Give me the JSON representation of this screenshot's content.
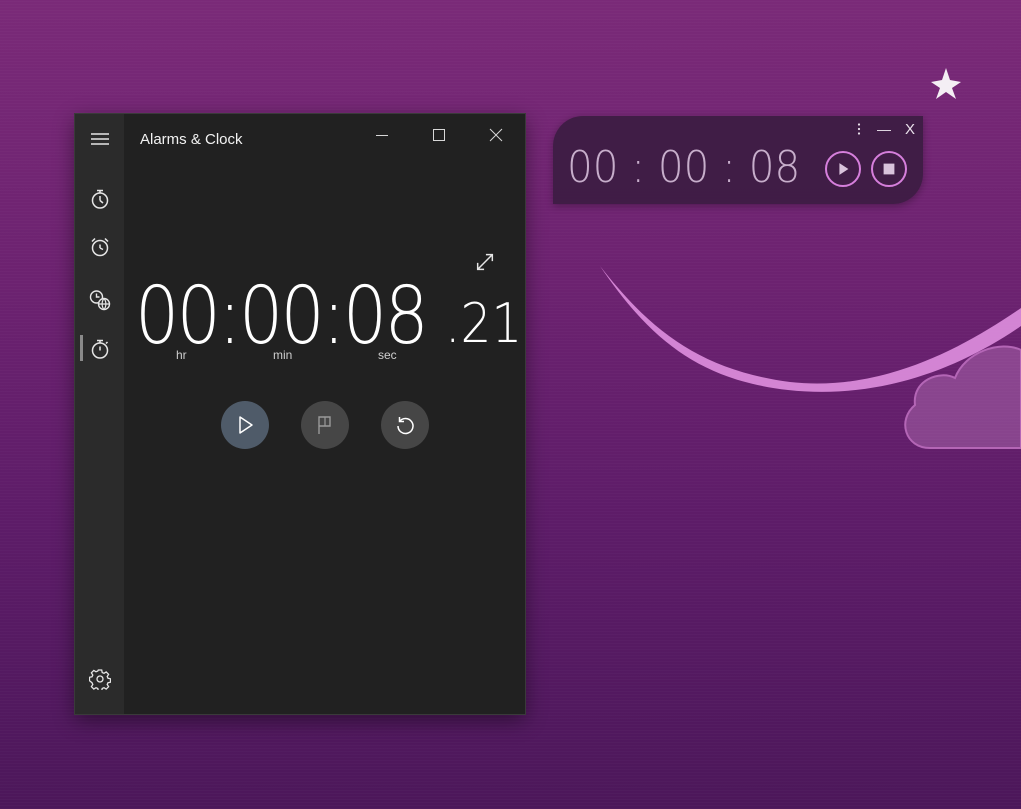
{
  "app": {
    "title": "Alarms & Clock",
    "window_controls": {
      "minimize": "minimize-icon",
      "maximize": "maximize-icon",
      "close": "close-icon"
    },
    "nav": [
      {
        "name": "timer",
        "icon": "timer-icon",
        "active": false
      },
      {
        "name": "alarm",
        "icon": "alarm-clock-icon",
        "active": false
      },
      {
        "name": "world-clock",
        "icon": "world-clock-icon",
        "active": false
      },
      {
        "name": "stopwatch",
        "icon": "stopwatch-icon",
        "active": true
      }
    ],
    "settings_icon": "gear-icon",
    "menu_icon": "hamburger-icon"
  },
  "stopwatch": {
    "main": "00:00:08",
    "fraction": ".21",
    "labels": {
      "hr": "hr",
      "min": "min",
      "sec": "sec"
    },
    "controls": {
      "start": "play-icon",
      "lap": "flag-icon",
      "reset": "reset-icon",
      "expand": "expand-icon"
    }
  },
  "mini_timer": {
    "time": "00 : 00 : 08",
    "controls": {
      "more": "more-vertical-icon",
      "minimize": "—",
      "close": "X",
      "play": "play-icon",
      "stop": "stop-icon"
    }
  },
  "colors": {
    "window_bg": "#212121",
    "rail_bg": "#2b2b2b",
    "play_button": "#4f5b69",
    "secondary_button": "#464646",
    "widget_accent": "#d67fdc",
    "widget_text": "#c7aecb"
  }
}
